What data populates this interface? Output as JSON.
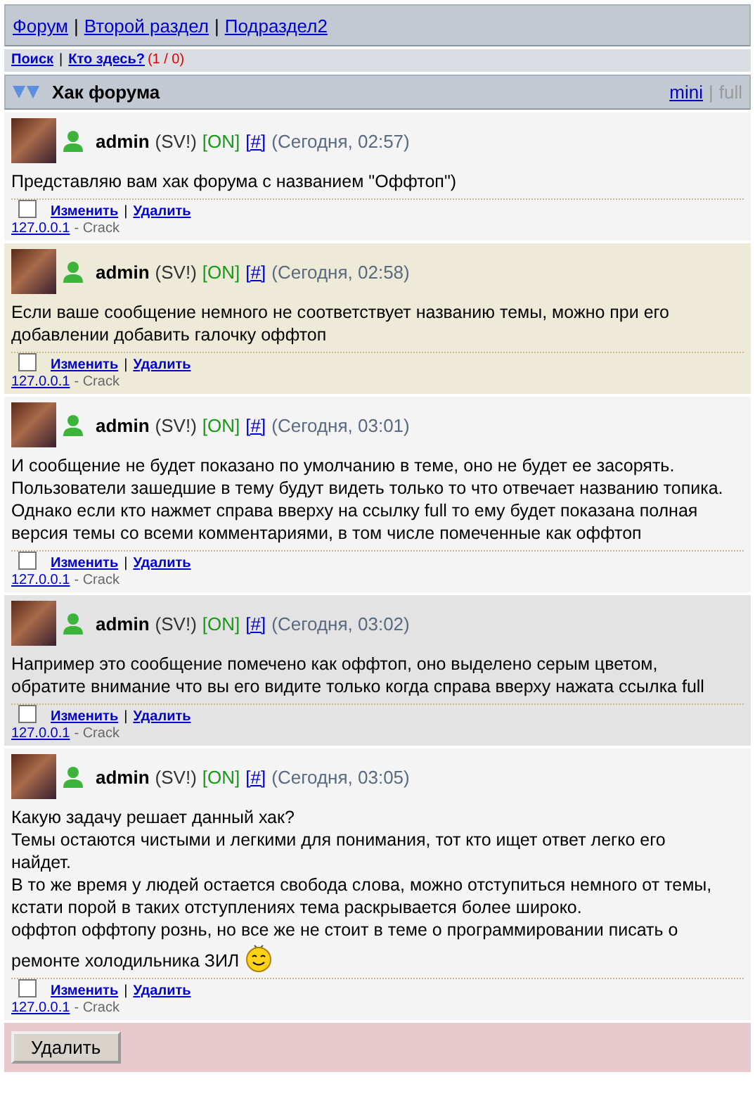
{
  "breadcrumbs": [
    {
      "kind": "link",
      "label": "Форум"
    },
    {
      "kind": "separator",
      "label": "|"
    },
    {
      "kind": "link",
      "label": "Второй раздел"
    },
    {
      "kind": "separator",
      "label": "|"
    },
    {
      "kind": "link",
      "label": "Подраздел2"
    }
  ],
  "subnav": {
    "items": [
      {
        "kind": "link",
        "label": "Поиск"
      },
      {
        "kind": "separator",
        "label": "|"
      },
      {
        "kind": "link",
        "label": "Кто здесь?"
      }
    ],
    "counter": "(1 / 0)"
  },
  "topic": {
    "title": "Хак форума",
    "views": [
      {
        "kind": "link",
        "label": "mini",
        "selected": false
      },
      {
        "kind": "separator",
        "label": "|"
      },
      {
        "kind": "link",
        "label": "full",
        "selected": true
      }
    ]
  },
  "posts": [
    {
      "kind": "normal",
      "author": "admin",
      "rank": "(SV!)",
      "status": "[ON]",
      "anchor": "[#]",
      "time": "(Сегодня, 02:57)",
      "lines": [
        "Представляю вам хак форума с названием \"Оффтоп\")"
      ],
      "smiley": false,
      "checked": false,
      "actions": [
        {
          "kind": "link",
          "label": "Изменить"
        },
        {
          "kind": "separator",
          "label": "|"
        },
        {
          "kind": "link",
          "label": "Удалить"
        }
      ],
      "ip": "127.0.0.1",
      "agent": "- Crack"
    },
    {
      "kind": "highlight",
      "author": "admin",
      "rank": "(SV!)",
      "status": "[ON]",
      "anchor": "[#]",
      "time": "(Сегодня, 02:58)",
      "lines": [
        "Если ваше сообщение немного не соответствует названию темы, можно при его",
        "добавлении добавить галочку оффтоп"
      ],
      "smiley": false,
      "checked": false,
      "actions": [
        {
          "kind": "link",
          "label": "Изменить"
        },
        {
          "kind": "separator",
          "label": "|"
        },
        {
          "kind": "link",
          "label": "Удалить"
        }
      ],
      "ip": "127.0.0.1",
      "agent": "- Crack"
    },
    {
      "kind": "normal",
      "author": "admin",
      "rank": "(SV!)",
      "status": "[ON]",
      "anchor": "[#]",
      "time": "(Сегодня, 03:01)",
      "lines": [
        "И сообщение не будет показано по умолчанию в теме, оно не будет ее засорять.",
        "Пользователи зашедшие в тему будут видеть только то что отвечает названию топика.",
        "Однако если кто нажмет справа вверху на ссылку full то ему будет показана полная",
        "версия темы со всеми комментариями, в том числе помеченные как оффтоп"
      ],
      "smiley": false,
      "checked": false,
      "actions": [
        {
          "kind": "link",
          "label": "Изменить"
        },
        {
          "kind": "separator",
          "label": "|"
        },
        {
          "kind": "link",
          "label": "Удалить"
        }
      ],
      "ip": "127.0.0.1",
      "agent": "- Crack"
    },
    {
      "kind": "offtopic",
      "author": "admin",
      "rank": "(SV!)",
      "status": "[ON]",
      "anchor": "[#]",
      "time": "(Сегодня, 03:02)",
      "lines": [
        "Например это сообщение помечено как оффтоп, оно выделено серым цветом,",
        "обратите внимание что вы его видите только когда справа вверху нажата ссылка full"
      ],
      "smiley": false,
      "checked": false,
      "actions": [
        {
          "kind": "link",
          "label": "Изменить"
        },
        {
          "kind": "separator",
          "label": "|"
        },
        {
          "kind": "link",
          "label": "Удалить"
        }
      ],
      "ip": "127.0.0.1",
      "agent": "- Crack"
    },
    {
      "kind": "normal",
      "author": "admin",
      "rank": "(SV!)",
      "status": "[ON]",
      "anchor": "[#]",
      "time": "(Сегодня, 03:05)",
      "lines": [
        "Какую задачу решает данный хак?",
        "Темы остаются чистыми и легкими для понимания, тот кто ищет ответ легко его",
        "найдет.",
        "В то же время у людей остается свобода слова, можно отступиться немного от темы,",
        "кстати порой в таких отступлениях тема раскрывается более широко.",
        "оффтоп оффтопу рознь, но все же не стоит в теме о программировании писать о",
        "ремонте холодильника ЗИЛ"
      ],
      "smiley": true,
      "checked": false,
      "actions": [
        {
          "kind": "link",
          "label": "Изменить"
        },
        {
          "kind": "separator",
          "label": "|"
        },
        {
          "kind": "link",
          "label": "Удалить"
        }
      ],
      "ip": "127.0.0.1",
      "agent": "- Crack"
    }
  ],
  "footer": {
    "button": "Удалить"
  }
}
